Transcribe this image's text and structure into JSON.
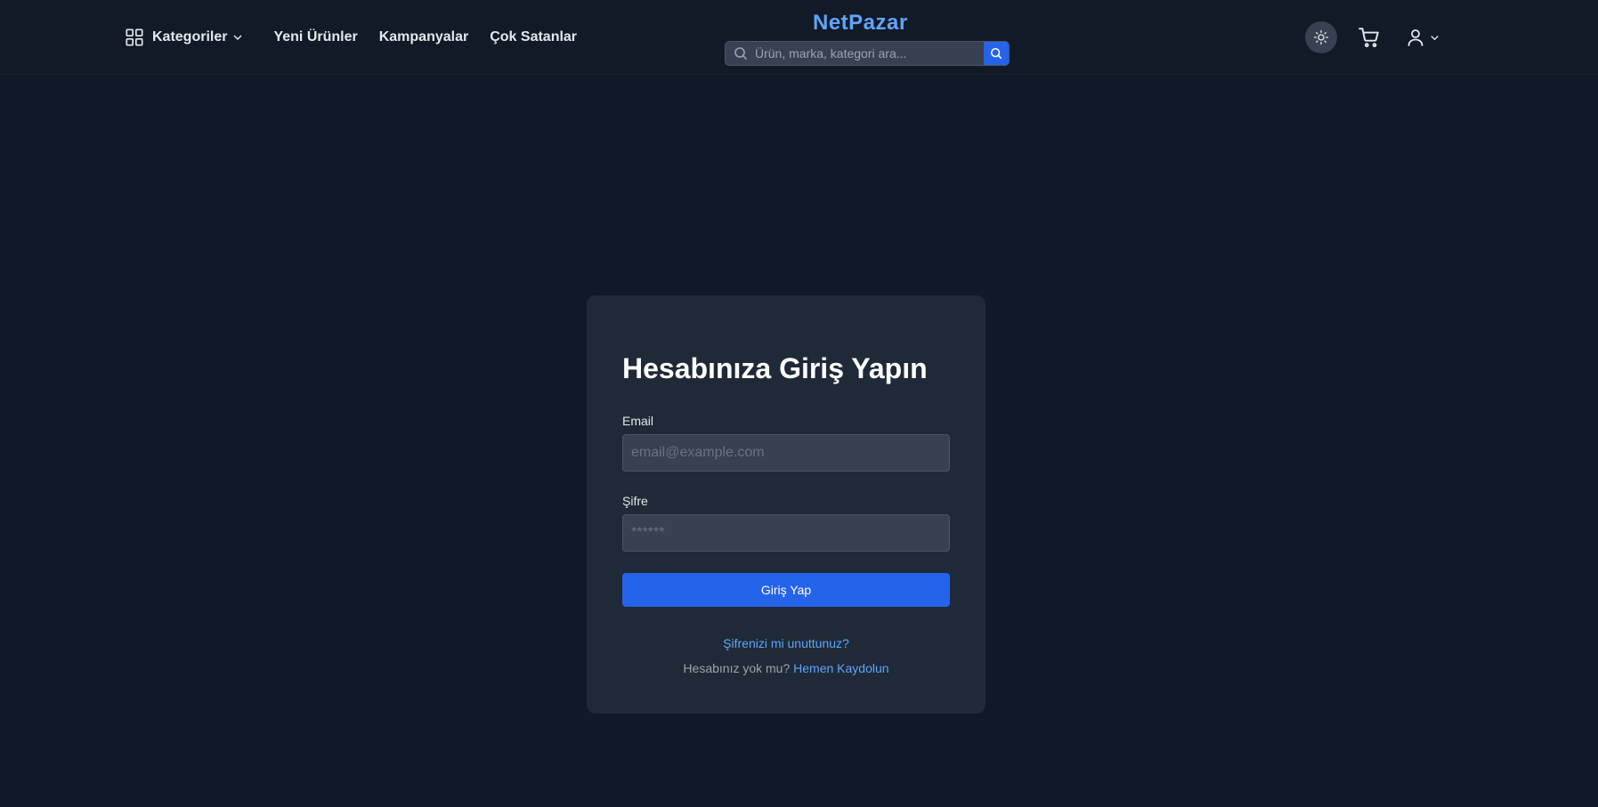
{
  "brand": "NetPazar",
  "nav": {
    "categories_label": "Kategoriler",
    "links": [
      "Yeni Ürünler",
      "Kampanyalar",
      "Çok Satanlar"
    ]
  },
  "search": {
    "placeholder": "Ürün, marka, kategori ara..."
  },
  "icons": {
    "categories": "grid-icon",
    "dropdown": "chevron-down-icon",
    "search": "search-icon",
    "theme": "sun-icon",
    "cart": "cart-icon",
    "user": "user-icon"
  },
  "login": {
    "title": "Hesabınıza Giriş Yapın",
    "email_label": "Email",
    "email_placeholder": "email@example.com",
    "email_value": "",
    "password_label": "Şifre",
    "password_placeholder": "******",
    "password_value": "",
    "submit_label": "Giriş Yap",
    "forgot_label": "Şifrenizi mi unuttunuz?",
    "register_prompt": "Hesabınız yok mu?",
    "register_link": "Hemen Kaydolun"
  },
  "colors": {
    "background": "#111827",
    "card": "#1f2937",
    "accent": "#2563eb",
    "brand": "#60a5fa",
    "link": "#60a5fa"
  }
}
